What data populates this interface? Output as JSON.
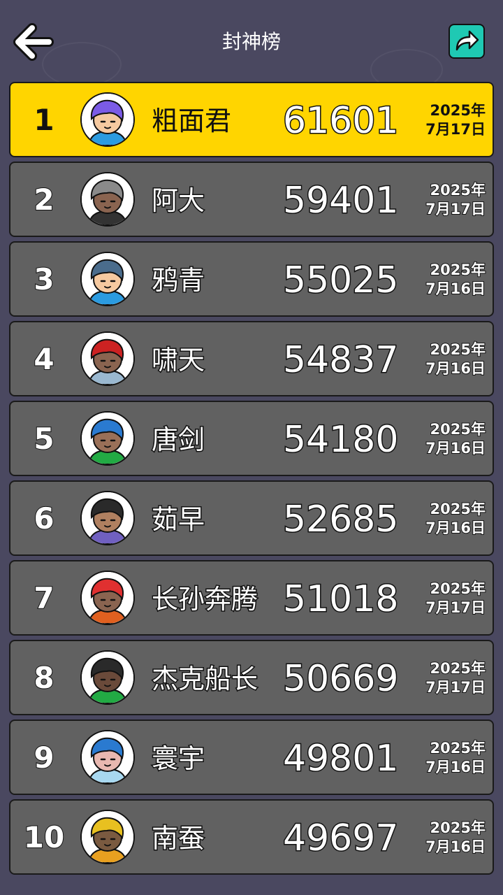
{
  "header": {
    "title": "封神榜",
    "back_icon": "arrow-left-icon",
    "share_icon": "share-arrow-icon",
    "share_color": "#1fc9b3"
  },
  "colors": {
    "background": "#4a4860",
    "row": "#616161",
    "highlight": "#ffd500"
  },
  "leaderboard": [
    {
      "rank": "1",
      "name": "粗面君",
      "score": "61601",
      "year": "2025年",
      "day": "7月17日",
      "hair": "#7b5be6",
      "shirt": "#2b9be0",
      "skin": "#f5c9a0"
    },
    {
      "rank": "2",
      "name": "阿大",
      "score": "59401",
      "year": "2025年",
      "day": "7月17日",
      "hair": "#8a8a8a",
      "shirt": "#333333",
      "skin": "#8a6450"
    },
    {
      "rank": "3",
      "name": "鸦青",
      "score": "55025",
      "year": "2025年",
      "day": "7月16日",
      "hair": "#4a6c8c",
      "shirt": "#2b9be0",
      "skin": "#f5c9a0"
    },
    {
      "rank": "4",
      "name": "啸天",
      "score": "54837",
      "year": "2025年",
      "day": "7月16日",
      "hair": "#cc2222",
      "shirt": "#9ab8d0",
      "skin": "#8a6450"
    },
    {
      "rank": "5",
      "name": "唐剑",
      "score": "54180",
      "year": "2025年",
      "day": "7月16日",
      "hair": "#2a7ad0",
      "shirt": "#22aa44",
      "skin": "#9a7058"
    },
    {
      "rank": "6",
      "name": "茹早",
      "score": "52685",
      "year": "2025年",
      "day": "7月16日",
      "hair": "#2a2a2a",
      "shirt": "#7060c0",
      "skin": "#b08060"
    },
    {
      "rank": "7",
      "name": "长孙奔腾",
      "score": "51018",
      "year": "2025年",
      "day": "7月17日",
      "hair": "#e03030",
      "shirt": "#e06020",
      "skin": "#8a6450"
    },
    {
      "rank": "8",
      "name": "杰克船长",
      "score": "50669",
      "year": "2025年",
      "day": "7月17日",
      "hair": "#2a2a2a",
      "shirt": "#22aa44",
      "skin": "#6a4a3a"
    },
    {
      "rank": "9",
      "name": "寰宇",
      "score": "49801",
      "year": "2025年",
      "day": "7月16日",
      "hair": "#2a7ad0",
      "shirt": "#a8d8f0",
      "skin": "#e8b8b0"
    },
    {
      "rank": "10",
      "name": "南蚕",
      "score": "49697",
      "year": "2025年",
      "day": "7月16日",
      "hair": "#e8c020",
      "shirt": "#e8a020",
      "skin": "#7a5a40"
    }
  ]
}
